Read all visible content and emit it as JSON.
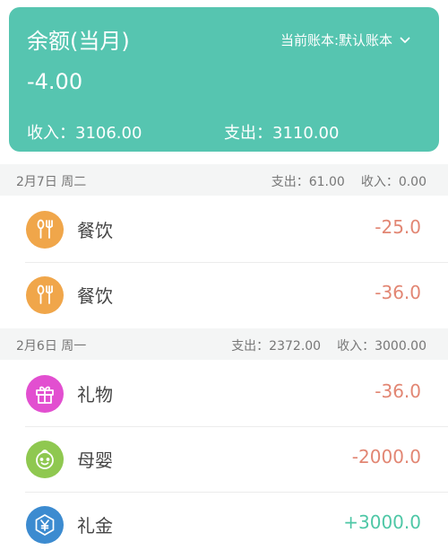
{
  "colors": {
    "card": "#56c5b0",
    "expense": "#e28673",
    "income": "#4ec7a6",
    "dining_icon": "#f0a64a",
    "gift_icon": "#e24fd0",
    "baby_icon": "#8fc850",
    "money_icon": "#3c8bd0"
  },
  "summary": {
    "title": "余额(当月)",
    "account_label": "当前账本:默认账本",
    "account_icon": "chevron-down-icon",
    "balance": "-4.00",
    "income": "收入：3106.00",
    "expense": "支出：3110.00"
  },
  "days": [
    {
      "date": "2月7日 周二",
      "expense": "支出：61.00",
      "income": "收入：0.00",
      "items": [
        {
          "category": "餐饮",
          "icon": "fork-spoon-icon",
          "amount": "-25.0",
          "type": "expense"
        },
        {
          "category": "餐饮",
          "icon": "fork-spoon-icon",
          "amount": "-36.0",
          "type": "expense"
        }
      ]
    },
    {
      "date": "2月6日 周一",
      "expense": "支出：2372.00",
      "income": "收入：3000.00",
      "items": [
        {
          "category": "礼物",
          "icon": "gift-icon",
          "amount": "-36.0",
          "type": "expense"
        },
        {
          "category": "母婴",
          "icon": "baby-face-icon",
          "amount": "-2000.0",
          "type": "expense"
        },
        {
          "category": "礼金",
          "icon": "yen-icon",
          "amount": "+3000.0",
          "type": "income"
        }
      ]
    }
  ]
}
